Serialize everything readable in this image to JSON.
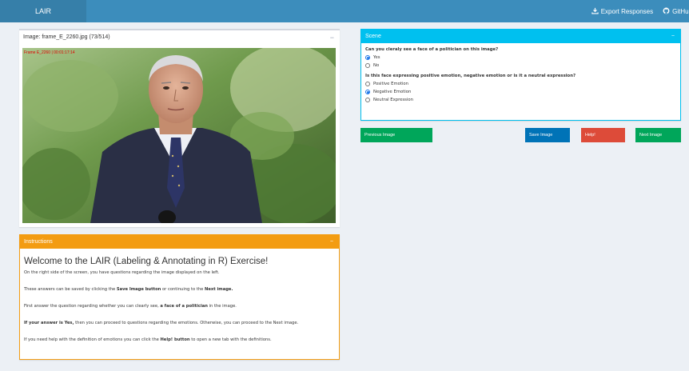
{
  "header": {
    "logo": "LAIR",
    "export_label": "Export Responses",
    "github_label": "GitHub"
  },
  "image_box": {
    "title": "Image: frame_E_2260.jpg (73/514)",
    "overlay_text": "Frame E_2260 | 00:01:17:14",
    "minimize": "−"
  },
  "instructions": {
    "header": "Instructions",
    "minimize": "−",
    "title": "Welcome to the LAIR (Labeling & Annotating in R) Exercise!",
    "p1": "On the right side of the screen, you have questions regarding the image displayed on the left.",
    "p2_a": "These answers can be saved by clicking the ",
    "p2_b": "Save Image button",
    "p2_c": " or continuing to the ",
    "p2_d": "Next image.",
    "p3_a": "First answer the question regarding whether you can clearly see, ",
    "p3_b": "a face of a politician",
    "p3_c": " in the image.",
    "p4_a": "If your answer is Yes,",
    "p4_b": " then you can proceed to questions regarding the emotions. Otherwise, you can proceed to the Next image.",
    "p5_a": "If you need help with the definition of emotions you can click the ",
    "p5_b": "Help! button",
    "p5_c": " to open a new tab with the definitions."
  },
  "scene": {
    "header": "Scene",
    "minimize": "−",
    "q1": "Can you cleraly see a face of a politician on this image?",
    "q1_options": [
      "Yes",
      "No"
    ],
    "q1_selected": "Yes",
    "q2": "Is this face expressing positive emotion, negative emotion or is it a neutral expression?",
    "q2_options": [
      "Positive Emotion",
      "Negative Emotion",
      "Neutral Expression"
    ],
    "q2_selected": "Negative Emotion"
  },
  "buttons": {
    "prev": "Previous Image",
    "save": "Save Image",
    "help": "Help!",
    "next": "Next Image"
  },
  "colors": {
    "topbar": "#3c8dbc",
    "logo_bg": "#367fa9",
    "instructions_accent": "#f39c12",
    "scene_accent": "#00c0ef",
    "green_button": "#00a65a",
    "blue_button": "#0073b7",
    "red_button": "#dd4b39"
  }
}
